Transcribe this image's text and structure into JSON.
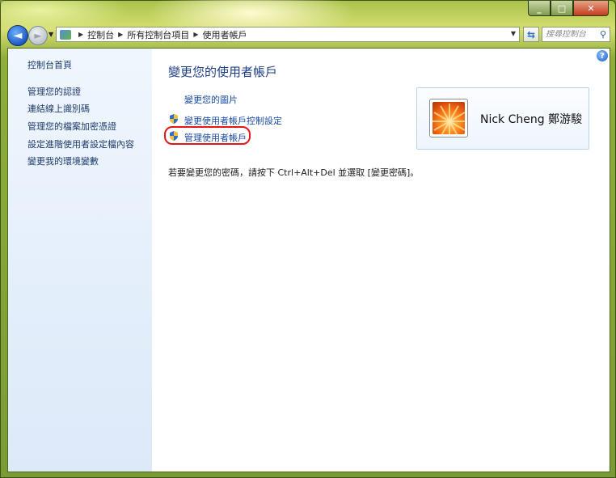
{
  "window": {
    "caption_buttons": {
      "minimize": "_",
      "maximize": "□",
      "close": "✕"
    }
  },
  "navbar": {
    "back_symbol": "◄",
    "forward_symbol": "►",
    "history_symbol": "▼",
    "breadcrumbs": [
      "控制台",
      "所有控制台項目",
      "使用者帳戶"
    ],
    "refresh_symbol": "⇆",
    "search_placeholder": "搜尋控制台"
  },
  "sidebar": {
    "items": [
      {
        "label": "控制台首頁"
      },
      {
        "label": "管理您的認證"
      },
      {
        "label": "連結線上識別碼"
      },
      {
        "label": "管理您的檔案加密憑證"
      },
      {
        "label": "設定進階使用者設定檔內容"
      },
      {
        "label": "變更我的環境變數"
      }
    ]
  },
  "main": {
    "title": "變更您的使用者帳戶",
    "links": [
      {
        "label": "變更您的圖片",
        "shield": false
      },
      {
        "label": "變更使用者帳戶控制設定",
        "shield": true
      },
      {
        "label": "管理使用者帳戶",
        "shield": true,
        "highlighted": true
      }
    ],
    "user": {
      "name": "Nick Cheng 鄭游駿"
    },
    "info": "若要變更您的密碼，請按下 Ctrl+Alt+Del 並選取 [變更密碼]。"
  },
  "colors": {
    "highlight_ring": "#e4161c",
    "link": "#1a4aa0",
    "title": "#1e3f86"
  }
}
